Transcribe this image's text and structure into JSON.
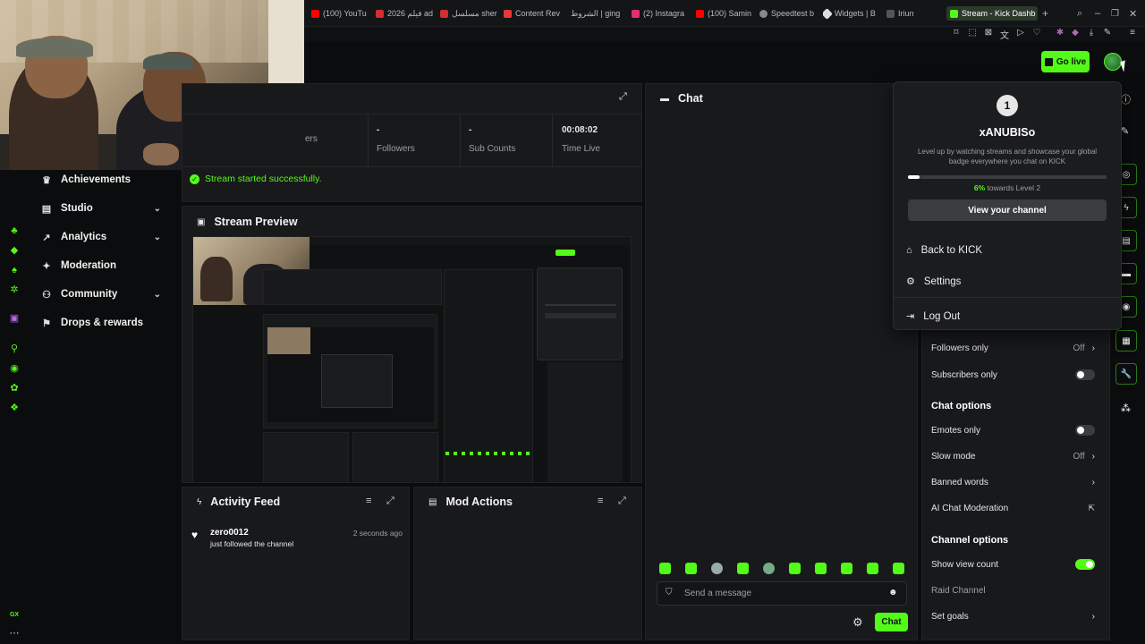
{
  "browser": {
    "tabs": [
      {
        "label": "(100) YouTu",
        "color": "#ff0000"
      },
      {
        "label": "فيلم 2026 ad",
        "color": "#d32f2f"
      },
      {
        "label": "مسلسل sher",
        "color": "#d32f2f"
      },
      {
        "label": "Content Rev",
        "color": "#e53935"
      },
      {
        "label": "الشروط | ging",
        "color": "#444"
      },
      {
        "label": "(2) Instagra",
        "color": "#e1306c"
      },
      {
        "label": "(100) Samin",
        "color": "#ff0000"
      },
      {
        "label": "Speedtest b",
        "color": "#888"
      },
      {
        "label": "Widgets | B",
        "color": "#ddd"
      },
      {
        "label": "Iriun",
        "color": "#aaa"
      }
    ],
    "active_tab": "Stream - Kick Dashb",
    "new_tab": "+"
  },
  "header": {
    "go_live": "Go live"
  },
  "stats": [
    {
      "value": "",
      "label": "ers"
    },
    {
      "value": "-",
      "label": "Followers"
    },
    {
      "value": "-",
      "label": "Sub Counts"
    },
    {
      "value": "00:08:02",
      "label": "Time Live"
    }
  ],
  "status_message": "Stream started successfully.",
  "sidebar": {
    "items": [
      {
        "label": "Achievements",
        "icon": "trophy-icon",
        "chevron": false
      },
      {
        "label": "Studio",
        "icon": "studio-icon",
        "chevron": true
      },
      {
        "label": "Analytics",
        "icon": "analytics-icon",
        "chevron": true
      },
      {
        "label": "Moderation",
        "icon": "moderation-icon",
        "chevron": false
      },
      {
        "label": "Community",
        "icon": "community-icon",
        "chevron": true
      },
      {
        "label": "Drops & rewards",
        "icon": "drops-icon",
        "chevron": false
      }
    ]
  },
  "left_strip_label": "GX",
  "stream_preview": {
    "title": "Stream Preview"
  },
  "activity_feed": {
    "title": "Activity Feed",
    "events": [
      {
        "user": "zero0012",
        "action": "just followed the channel",
        "time": "2 seconds ago"
      }
    ]
  },
  "mod_actions": {
    "title": "Mod Actions"
  },
  "chat": {
    "title": "Chat",
    "placeholder": "Send a message",
    "send_label": "Chat"
  },
  "profile_menu": {
    "level": "1",
    "username": "xANUBISo",
    "description": "Level up by watching streams and showcase your global badge everywhere you chat on KICK",
    "progress_percent": "6%",
    "progress_fraction": 0.06,
    "progress_text": "towards Level 2",
    "view_channel": "View your channel",
    "items": [
      {
        "label": "Back to KICK",
        "icon": "home-icon"
      },
      {
        "label": "Settings",
        "icon": "gear-icon"
      },
      {
        "label": "Log Out",
        "icon": "logout-icon"
      }
    ]
  },
  "chat_settings": {
    "followers_only": {
      "label": "Followers only",
      "value": "Off"
    },
    "subscribers_only": {
      "label": "Subscribers only",
      "on": false
    },
    "chat_options_title": "Chat options",
    "emotes_only": {
      "label": "Emotes only",
      "on": false
    },
    "slow_mode": {
      "label": "Slow mode",
      "value": "Off"
    },
    "banned_words": {
      "label": "Banned words"
    },
    "ai_moderation": {
      "label": "AI Chat Moderation"
    },
    "channel_options_title": "Channel options",
    "show_view_count": {
      "label": "Show view count",
      "on": true
    },
    "raid_channel": {
      "label": "Raid Channel"
    },
    "set_goals": {
      "label": "Set goals"
    }
  },
  "colors": {
    "accent": "#53fc18",
    "panel": "#18191b",
    "bg": "#0b0c0d"
  }
}
